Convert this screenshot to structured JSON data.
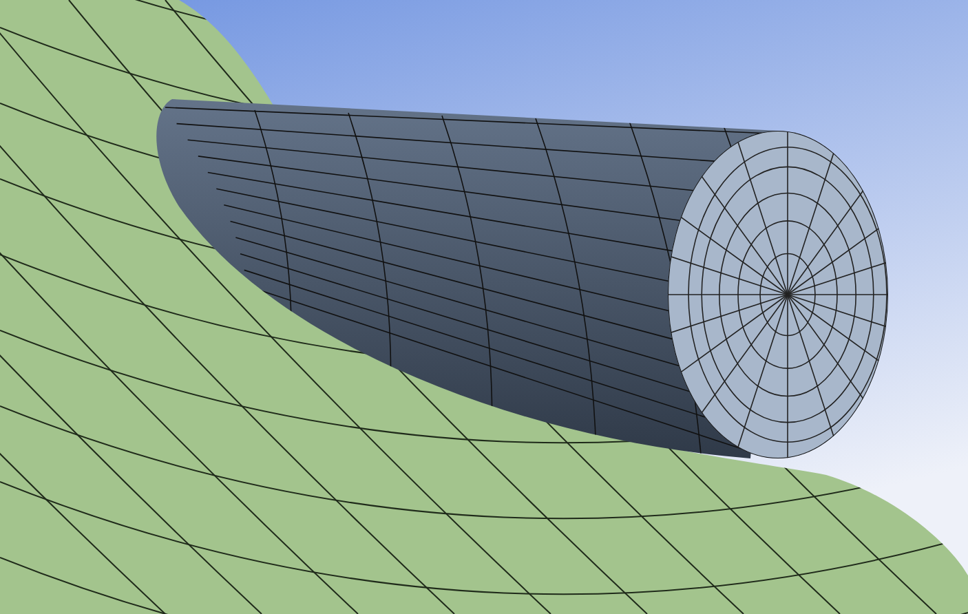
{
  "scene": {
    "kind": "mesh"
  }
}
